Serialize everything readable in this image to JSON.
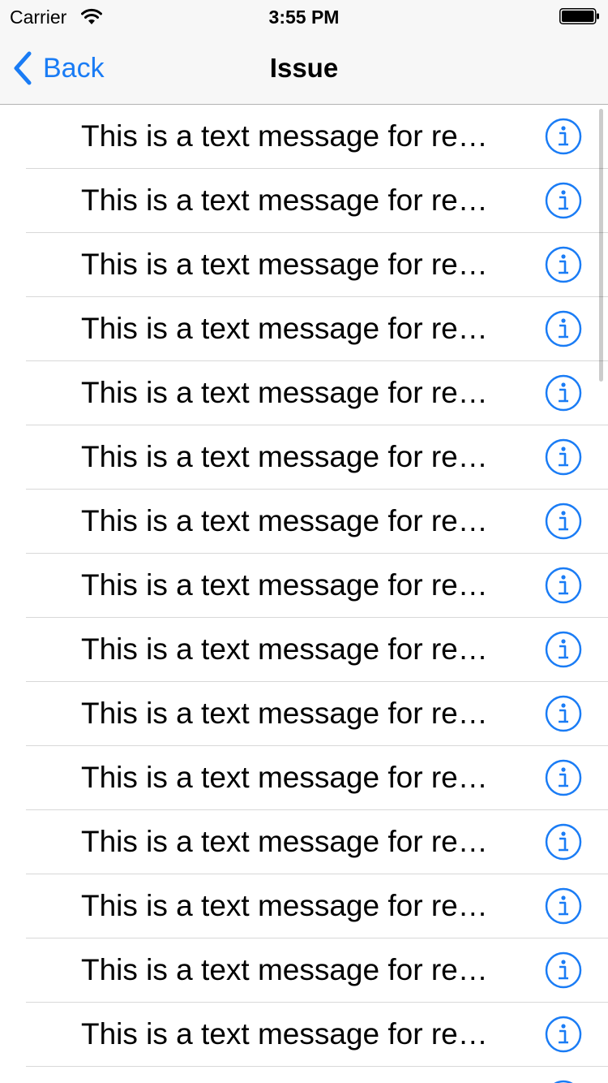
{
  "status_bar": {
    "carrier": "Carrier",
    "time": "3:55 PM",
    "wifi_icon": "wifi-icon",
    "battery_icon": "battery-icon"
  },
  "nav": {
    "back_label": "Back",
    "back_icon": "chevron-left-icon",
    "title": "Issue"
  },
  "rows": [
    {
      "text": "This is a text message for re…",
      "accessory_icon": "info-icon"
    },
    {
      "text": "This is a text message for re…",
      "accessory_icon": "info-icon"
    },
    {
      "text": "This is a text message for re…",
      "accessory_icon": "info-icon"
    },
    {
      "text": "This is a text message for re…",
      "accessory_icon": "info-icon"
    },
    {
      "text": "This is a text message for re…",
      "accessory_icon": "info-icon"
    },
    {
      "text": "This is a text message for re…",
      "accessory_icon": "info-icon"
    },
    {
      "text": "This is a text message for re…",
      "accessory_icon": "info-icon"
    },
    {
      "text": "This is a text message for re…",
      "accessory_icon": "info-icon"
    },
    {
      "text": "This is a text message for re…",
      "accessory_icon": "info-icon"
    },
    {
      "text": "This is a text message for re…",
      "accessory_icon": "info-icon"
    },
    {
      "text": "This is a text message for re…",
      "accessory_icon": "info-icon"
    },
    {
      "text": "This is a text message for re…",
      "accessory_icon": "info-icon"
    },
    {
      "text": "This is a text message for re…",
      "accessory_icon": "info-icon"
    },
    {
      "text": "This is a text message for re…",
      "accessory_icon": "info-icon"
    },
    {
      "text": "This is a text message for re…",
      "accessory_icon": "info-icon"
    },
    {
      "text": "",
      "accessory_icon": "info-icon"
    }
  ],
  "colors": {
    "tint": "#1a7cf5",
    "nav_background": "#f7f7f7",
    "separator": "#d8d8d8",
    "text": "#000000"
  }
}
